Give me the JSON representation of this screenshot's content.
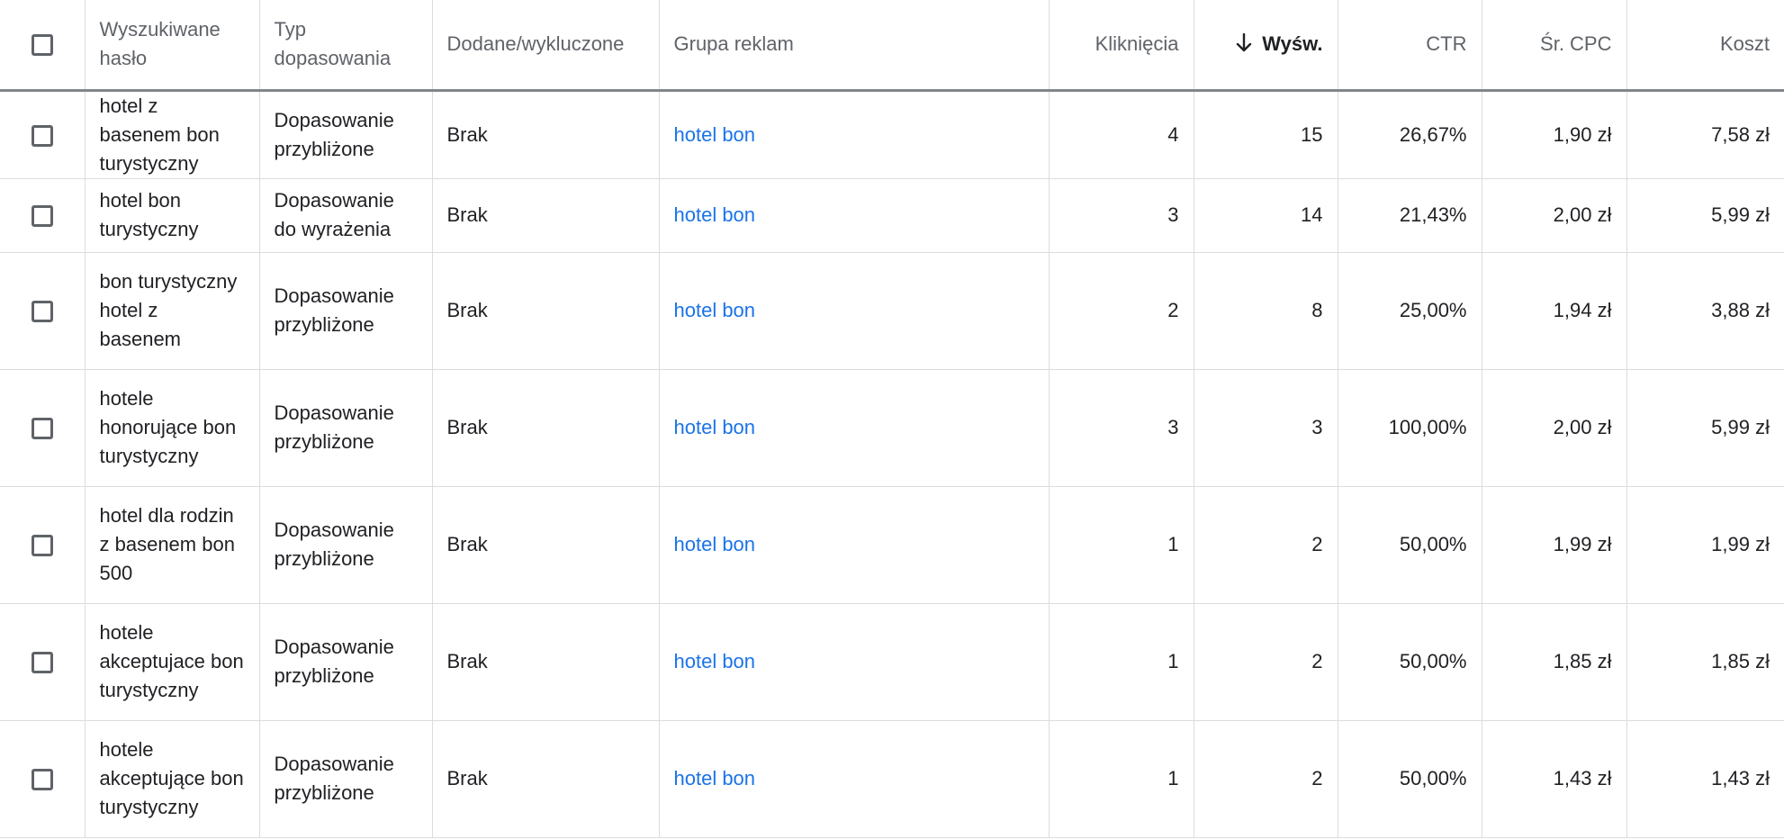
{
  "header": {
    "keyword": "Wyszukiwane hasło",
    "match_type": "Typ dopasowania",
    "added_excluded": "Dodane/wykluczone",
    "ad_group": "Grupa reklam",
    "clicks": "Kliknięcia",
    "impressions": "Wyśw.",
    "ctr": "CTR",
    "avg_cpc": "Śr. CPC",
    "cost": "Koszt",
    "sort_icon": "arrow-down-icon"
  },
  "rows": [
    {
      "keyword": "hotel z basenem bon turystyczny",
      "match_type": "Dopasowanie przybliżone",
      "added": "Brak",
      "ad_group": "hotel bon",
      "clicks": "4",
      "impressions": "15",
      "ctr": "26,67%",
      "avg_cpc": "1,90 zł",
      "cost": "7,58 zł"
    },
    {
      "keyword": "hotel bon turystyczny",
      "match_type": "Dopasowanie do wyrażenia",
      "added": "Brak",
      "ad_group": "hotel bon",
      "clicks": "3",
      "impressions": "14",
      "ctr": "21,43%",
      "avg_cpc": "2,00 zł",
      "cost": "5,99 zł"
    },
    {
      "keyword": "bon turystyczny hotel z basenem",
      "match_type": "Dopasowanie przybliżone",
      "added": "Brak",
      "ad_group": "hotel bon",
      "clicks": "2",
      "impressions": "8",
      "ctr": "25,00%",
      "avg_cpc": "1,94 zł",
      "cost": "3,88 zł"
    },
    {
      "keyword": "hotele honorujące bon turystyczny",
      "match_type": "Dopasowanie przybliżone",
      "added": "Brak",
      "ad_group": "hotel bon",
      "clicks": "3",
      "impressions": "3",
      "ctr": "100,00%",
      "avg_cpc": "2,00 zł",
      "cost": "5,99 zł"
    },
    {
      "keyword": "hotel dla rodzin z basenem bon 500",
      "match_type": "Dopasowanie przybliżone",
      "added": "Brak",
      "ad_group": "hotel bon",
      "clicks": "1",
      "impressions": "2",
      "ctr": "50,00%",
      "avg_cpc": "1,99 zł",
      "cost": "1,99 zł"
    },
    {
      "keyword": "hotele akceptujace bon turystyczny",
      "match_type": "Dopasowanie przybliżone",
      "added": "Brak",
      "ad_group": "hotel bon",
      "clicks": "1",
      "impressions": "2",
      "ctr": "50,00%",
      "avg_cpc": "1,85 zł",
      "cost": "1,85 zł"
    },
    {
      "keyword": "hotele akceptujące bon turystyczny",
      "match_type": "Dopasowanie przybliżone",
      "added": "Brak",
      "ad_group": "hotel bon",
      "clicks": "1",
      "impressions": "2",
      "ctr": "50,00%",
      "avg_cpc": "1,43 zł",
      "cost": "1,43 zł"
    }
  ]
}
